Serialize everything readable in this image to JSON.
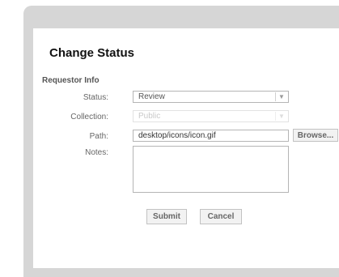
{
  "dialog": {
    "title": "Change Status",
    "section_label": "Requestor Info",
    "fields": {
      "status": {
        "label": "Status:",
        "value": "Review"
      },
      "collection": {
        "label": "Collection:",
        "value": "Public"
      },
      "path": {
        "label": "Path:",
        "value": "desktop/icons/icon.gif"
      },
      "notes": {
        "label": "Notes:",
        "value": ""
      }
    },
    "buttons": {
      "browse": "Browse...",
      "submit": "Submit",
      "cancel": "Cancel"
    }
  },
  "icons": {
    "dropdown_arrow": "chevron-down-icon"
  },
  "colors": {
    "frame": "#d6d6d6",
    "panel": "#ffffff",
    "title": "#111111"
  }
}
